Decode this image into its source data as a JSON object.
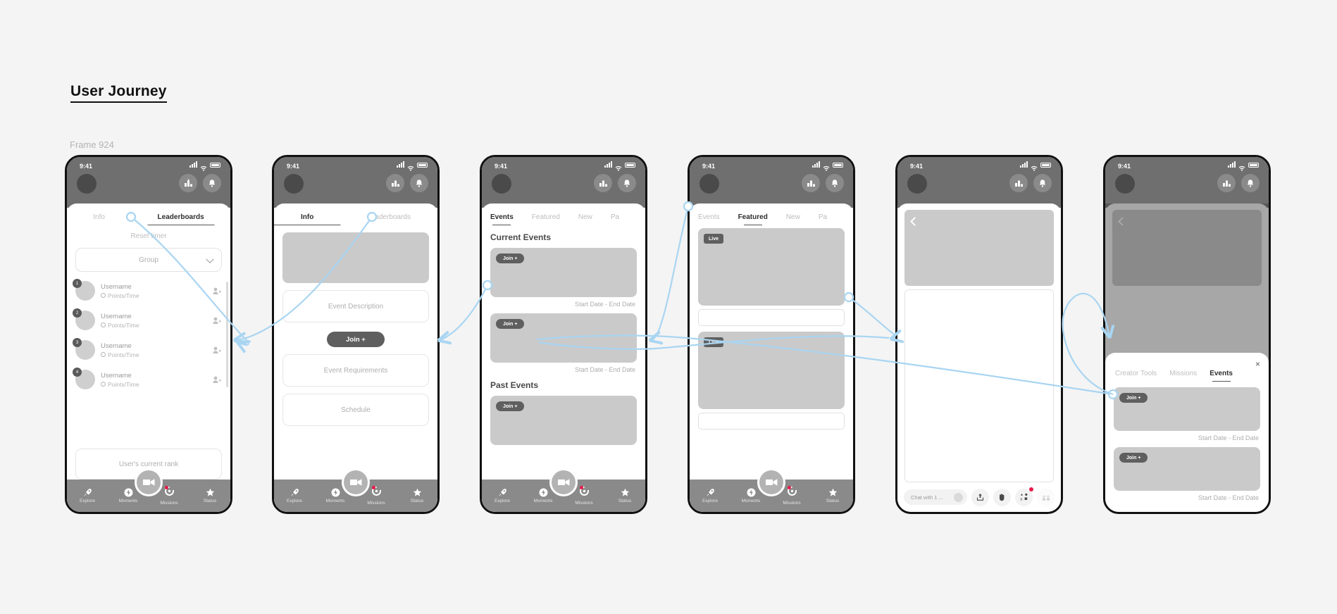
{
  "page": {
    "title": "User Journey",
    "frame_label": "Frame 924",
    "background": "#F4F4F4",
    "connector_color": "#A9D5F2"
  },
  "status_bar": {
    "time": "9:41",
    "icons": [
      "signal-icon",
      "wifi-icon",
      "battery-icon",
      "avatar",
      "leaderboard-icon",
      "bell-icon"
    ]
  },
  "bottom_nav": {
    "items": [
      {
        "label": "Explore",
        "icon": "rocket-icon"
      },
      {
        "label": "Moments",
        "icon": "lightning-icon"
      },
      {
        "label": "Missions",
        "icon": "target-icon"
      },
      {
        "label": "Status",
        "icon": "star-icon"
      }
    ],
    "center_icon": "camera-icon"
  },
  "screens": [
    {
      "id": "leaderboards",
      "tabs": [
        {
          "label": "Info",
          "active": false
        },
        {
          "label": "Leaderboards",
          "active": true
        }
      ],
      "reset_timer": "Reset timer",
      "group_dropdown": {
        "value": "Group",
        "icon": "chevron-down-icon"
      },
      "rows": [
        {
          "name": "Username",
          "sub": "Points/Time",
          "rank": "1"
        },
        {
          "name": "Username",
          "sub": "Points/Time",
          "rank": "2"
        },
        {
          "name": "Username",
          "sub": "Points/Time",
          "rank": "3"
        },
        {
          "name": "Username",
          "sub": "Points/Time",
          "rank": "4"
        }
      ],
      "current_rank": "User's current rank"
    },
    {
      "id": "event-info",
      "tabs": [
        {
          "label": "Info",
          "active": true
        },
        {
          "label": "Leaderboards",
          "active": false
        }
      ],
      "fields": [
        "Event Description",
        "Event Requirements",
        "Schedule"
      ],
      "join_label": "Join +"
    },
    {
      "id": "events-list",
      "tabs": [
        {
          "label": "Events",
          "active": true
        },
        {
          "label": "Featured",
          "active": false
        },
        {
          "label": "New",
          "active": false
        },
        {
          "label": "Pa",
          "active": false
        }
      ],
      "sections": [
        {
          "heading": "Current Events",
          "cards": [
            {
              "chip": "Join +",
              "date": "Start Date -  End Date"
            },
            {
              "chip": "Join +",
              "date": "Start Date -  End Date"
            }
          ]
        },
        {
          "heading": "Past Events",
          "cards": [
            {
              "chip": "Join +",
              "date": ""
            }
          ]
        }
      ]
    },
    {
      "id": "featured",
      "tabs": [
        {
          "label": "Events",
          "active": false
        },
        {
          "label": "Featured",
          "active": true
        },
        {
          "label": "New",
          "active": false
        },
        {
          "label": "Pa",
          "active": false
        }
      ],
      "cards": [
        {
          "chip": "Live"
        },
        {
          "chip": "Live"
        }
      ]
    },
    {
      "id": "live-stream",
      "back_icon": "back-chevron-icon",
      "chat_placeholder": "Chat with 1 ...",
      "actions": [
        "share-icon",
        "hand-icon",
        "shapes-icon",
        "gift-icon"
      ]
    },
    {
      "id": "creator-sheet",
      "close_label": "×",
      "tabs": [
        {
          "label": "Creator Tools",
          "active": false
        },
        {
          "label": "Missions",
          "active": false
        },
        {
          "label": "Events",
          "active": true
        }
      ],
      "cards": [
        {
          "chip": "Join +",
          "date": "Start Date -  End Date"
        },
        {
          "chip": "Join +",
          "date": "Start Date -  End Date"
        }
      ]
    }
  ]
}
